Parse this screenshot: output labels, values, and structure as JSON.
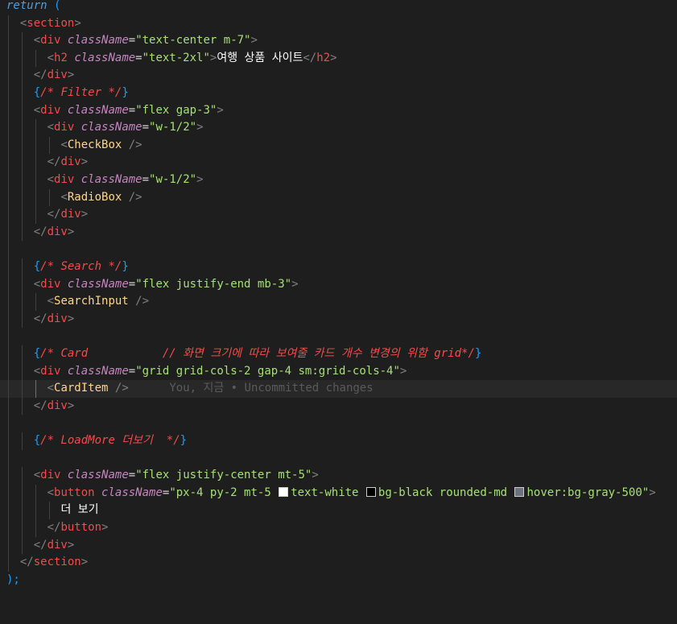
{
  "editor": {
    "language": "jsx",
    "current_line": 22,
    "blame": "You, 지금 • Uncommitted changes",
    "colors": {
      "background": "#1e1e1e",
      "keyword": "#569cd6",
      "tag": "#f14c4c",
      "component": "#ffd68a",
      "attribute": "#c586c0",
      "string": "#a5e075",
      "comment": "#f14c4c",
      "bracket": "#179fff"
    }
  },
  "code": {
    "return_kw": "return",
    "open_paren": "(",
    "close_paren": ");",
    "section_tag": "section",
    "div_tag": "div",
    "h2_tag": "h2",
    "button_tag": "button",
    "classname_attr": "className",
    "cls_header": "\"text-center m-7\"",
    "cls_h2": "\"text-2xl\"",
    "h2_text": "여행 상품 사이트",
    "cmt_filter": "/* Filter */",
    "cls_filter_row": "\"flex gap-3\"",
    "cls_half": "\"w-1/2\"",
    "checkbox_comp": "CheckBox",
    "radiobox_comp": "RadioBox",
    "cmt_search": "/* Search */",
    "cls_search_row": "\"flex justify-end mb-3\"",
    "searchinput_comp": "SearchInput",
    "cmt_card": "/* Card           // 화면 크기에 따라 보여줄 카드 개수 변경의 위함 grid*/",
    "cls_grid": "\"grid grid-cols-2 gap-4 sm:grid-cols-4\"",
    "carditem_comp": "CardItem",
    "cmt_loadmore": "/* LoadMore 더보기  */",
    "cls_loadmore_row": "\"flex justify-center mt-5\"",
    "cls_button_a": "\"px-4 py-2 mt-5 ",
    "cls_button_b": "text-white ",
    "cls_button_c": "bg-black rounded-md ",
    "cls_button_d": "hover:bg-gray-500\"",
    "button_text": "더 보기",
    "swatches": {
      "white": "#ffffff",
      "black": "#000000",
      "gray500": "#6b7280"
    }
  }
}
